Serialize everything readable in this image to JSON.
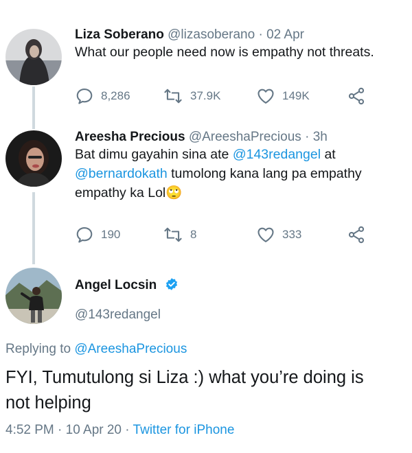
{
  "tweets": [
    {
      "name": "Liza Soberano",
      "handle": "@lizasoberano",
      "sep": "·",
      "time": "02 Apr",
      "text": "What our people need now is empathy not threats.",
      "replies": "8,286",
      "retweets": "37.9K",
      "likes": "149K"
    },
    {
      "name": "Areesha Precious",
      "handle": "@AreeshaPrecious",
      "sep": "·",
      "time": "3h",
      "text_1": "Bat dimu gayahin sina ate ",
      "mention_1": "@143redangel",
      "text_2": " at",
      "mention_2": "@bernardokath",
      "text_3": " tumolong kana lang pa empathy",
      "text_4": "empathy ka Lol",
      "emoji": "🙄",
      "replies": "190",
      "retweets": "8",
      "likes": "333"
    }
  ],
  "focus": {
    "name": "Angel Locsin",
    "handle": "@143redangel",
    "replying_prefix": "Replying to ",
    "replying_to": "@AreeshaPrecious",
    "text_line_1": "FYI, Tumutulong si Liza :) what you’re doing is",
    "text_line_2": "not helping",
    "time": "4:52 PM",
    "sep": "·",
    "date": "10 Apr 20",
    "source": "Twitter for iPhone"
  },
  "icons": {
    "reply": "reply-icon",
    "retweet": "retweet-icon",
    "like": "heart-icon",
    "share": "share-icon",
    "verified": "verified-badge-icon"
  },
  "colors": {
    "link": "#1b95e0",
    "muted": "#657786",
    "text": "#14171a",
    "thread_line": "#cfd9de",
    "verified": "#1da1f2"
  }
}
